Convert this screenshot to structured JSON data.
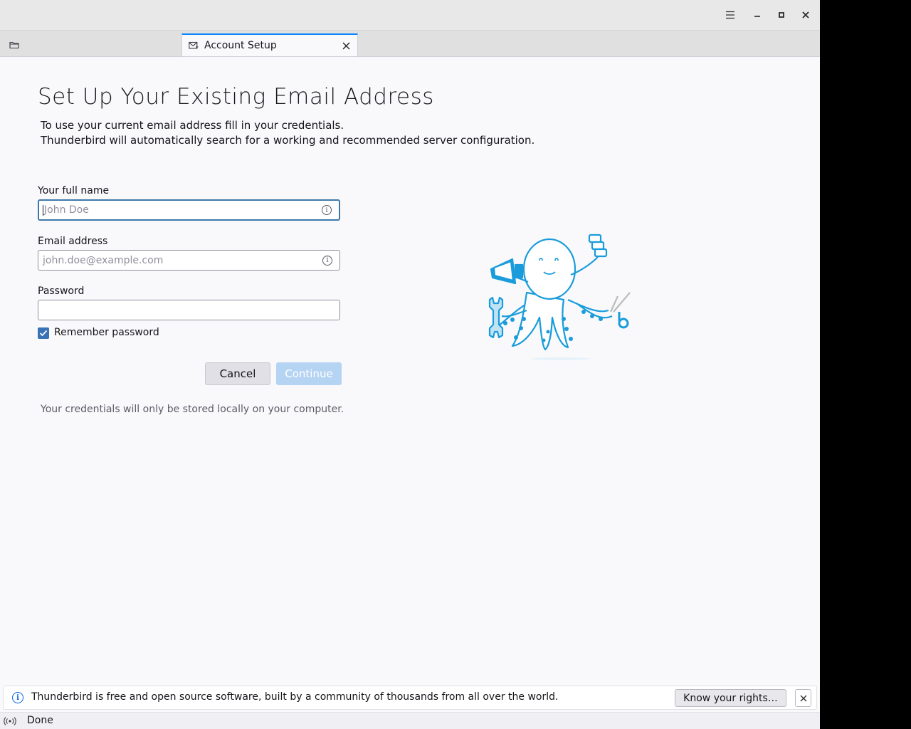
{
  "window": {
    "controls": {
      "menu_icon": "hamburger-menu-icon",
      "minimize_icon": "minimize-icon",
      "maximize_icon": "maximize-icon",
      "close_icon": "close-icon"
    }
  },
  "tabs": {
    "folder_tab_icon": "folder-icon",
    "active_tab": {
      "label": "Account Setup",
      "icon": "account-setup-icon",
      "close_icon": "close-icon"
    }
  },
  "page": {
    "title": "Set Up Your Existing Email Address",
    "subtitle_line1": "To use your current email address fill in your credentials.",
    "subtitle_line2": "Thunderbird will automatically search for a working and recommended server configuration."
  },
  "form": {
    "full_name": {
      "label": "Your full name",
      "placeholder": "John Doe",
      "value": ""
    },
    "email": {
      "label": "Email address",
      "placeholder": "john.doe@example.com",
      "value": ""
    },
    "password": {
      "label": "Password",
      "value": ""
    },
    "remember_password": {
      "label": "Remember password",
      "checked": true
    },
    "cancel_label": "Cancel",
    "continue_label": "Continue",
    "note": "Your credentials will only be stored locally on your computer."
  },
  "notification": {
    "text": "Thunderbird is free and open source software, built by a community of thousands from all over the world.",
    "button_label": "Know your rights…",
    "icon": "info-icon"
  },
  "status": {
    "text": "Done",
    "icon": "connection-status-icon"
  },
  "colors": {
    "accent": "#0a84ff",
    "checkbox": "#3973b5",
    "continue_disabled": "#b5d3f2",
    "mascot": "#1a9cdb"
  }
}
